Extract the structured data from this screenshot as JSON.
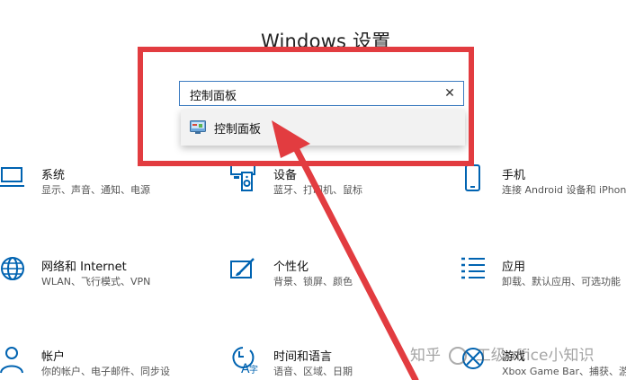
{
  "window": {
    "title": "Windows 设置"
  },
  "search": {
    "value": "控制面板",
    "clear_glyph": "✕"
  },
  "suggestion": {
    "label": "控制面板",
    "icon": "control-panel-icon"
  },
  "categories": [
    {
      "title": "系统",
      "desc": "显示、声音、通知、电源",
      "icon": "laptop-icon"
    },
    {
      "title": "设备",
      "desc": "蓝牙、打印机、鼠标",
      "icon": "devices-icon"
    },
    {
      "title": "手机",
      "desc": "连接 Android 设备和 iPhone",
      "icon": "phone-icon"
    },
    {
      "title": "网络和 Internet",
      "desc": "WLAN、飞行模式、VPN",
      "icon": "globe-icon"
    },
    {
      "title": "个性化",
      "desc": "背景、锁屏、颜色",
      "icon": "brush-icon"
    },
    {
      "title": "应用",
      "desc": "卸载、默认应用、可选功能",
      "icon": "apps-list-icon"
    },
    {
      "title": "帐户",
      "desc": "你的帐户、电子邮件、同步设",
      "icon": "person-icon"
    },
    {
      "title": "时间和语言",
      "desc": "语音、区域、日期",
      "icon": "time-language-icon"
    },
    {
      "title": "游戏",
      "desc": "Xbox Game Bar、捕获、游",
      "icon": "xbox-icon"
    }
  ],
  "watermark": {
    "text_left": "知乎",
    "text_right": "工级office小知识"
  },
  "colors": {
    "accent": "#0063b1",
    "annotation_red": "#e23c40",
    "search_border": "#3b7bc0"
  }
}
